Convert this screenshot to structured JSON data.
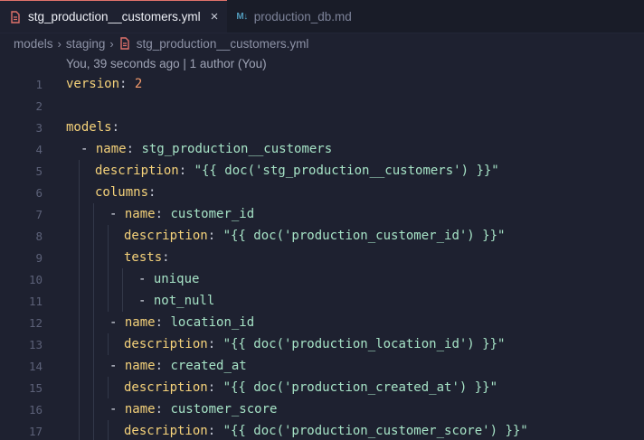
{
  "tabs": [
    {
      "label": "stg_production__customers.yml",
      "icon": "yaml-file-icon",
      "active": true
    },
    {
      "label": "production_db.md",
      "icon": "markdown-file-icon",
      "icon_text": "M↓",
      "active": false
    }
  ],
  "close_glyph": "×",
  "breadcrumb": {
    "segments": [
      "models",
      "staging",
      "stg_production__customers.yml"
    ],
    "separator": "›"
  },
  "blame": "You, 39 seconds ago | 1 author (You)",
  "colors": {
    "key": "#f5d27a",
    "string": "#a6e3c6",
    "number": "#f39a6b",
    "accent": "#e0726b"
  },
  "lines": [
    {
      "n": "1",
      "dash": "",
      "key": "version",
      "sep": ": ",
      "val": "2",
      "valType": "num",
      "indent": 0
    },
    {
      "n": "2",
      "dash": "",
      "key": "",
      "sep": "",
      "val": "",
      "valType": "",
      "indent": 0
    },
    {
      "n": "3",
      "dash": "",
      "key": "models",
      "sep": ":",
      "val": "",
      "valType": "",
      "indent": 0
    },
    {
      "n": "4",
      "dash": "- ",
      "key": "name",
      "sep": ": ",
      "val": "stg_production__customers",
      "valType": "str",
      "indent": 1
    },
    {
      "n": "5",
      "dash": "",
      "key": "description",
      "sep": ": ",
      "val": "\"{{ doc('stg_production__customers') }}\"",
      "valType": "str",
      "indent": 2
    },
    {
      "n": "6",
      "dash": "",
      "key": "columns",
      "sep": ":",
      "val": "",
      "valType": "",
      "indent": 2
    },
    {
      "n": "7",
      "dash": "- ",
      "key": "name",
      "sep": ": ",
      "val": "customer_id",
      "valType": "str",
      "indent": 3
    },
    {
      "n": "8",
      "dash": "",
      "key": "description",
      "sep": ": ",
      "val": "\"{{ doc('production_customer_id') }}\"",
      "valType": "str",
      "indent": 4
    },
    {
      "n": "9",
      "dash": "",
      "key": "tests",
      "sep": ":",
      "val": "",
      "valType": "",
      "indent": 4
    },
    {
      "n": "10",
      "dash": "- ",
      "key": "",
      "sep": "",
      "val": "unique",
      "valType": "str",
      "indent": 5
    },
    {
      "n": "11",
      "dash": "- ",
      "key": "",
      "sep": "",
      "val": "not_null",
      "valType": "str",
      "indent": 5
    },
    {
      "n": "12",
      "dash": "- ",
      "key": "name",
      "sep": ": ",
      "val": "location_id",
      "valType": "str",
      "indent": 3
    },
    {
      "n": "13",
      "dash": "",
      "key": "description",
      "sep": ": ",
      "val": "\"{{ doc('production_location_id') }}\"",
      "valType": "str",
      "indent": 4
    },
    {
      "n": "14",
      "dash": "- ",
      "key": "name",
      "sep": ": ",
      "val": "created_at",
      "valType": "str",
      "indent": 3
    },
    {
      "n": "15",
      "dash": "",
      "key": "description",
      "sep": ": ",
      "val": "\"{{ doc('production_created_at') }}\"",
      "valType": "str",
      "indent": 4
    },
    {
      "n": "16",
      "dash": "- ",
      "key": "name",
      "sep": ": ",
      "val": "customer_score",
      "valType": "str",
      "indent": 3
    },
    {
      "n": "17",
      "dash": "",
      "key": "description",
      "sep": ": ",
      "val": "\"{{ doc('production_customer_score') }}\"",
      "valType": "str",
      "indent": 4
    }
  ]
}
